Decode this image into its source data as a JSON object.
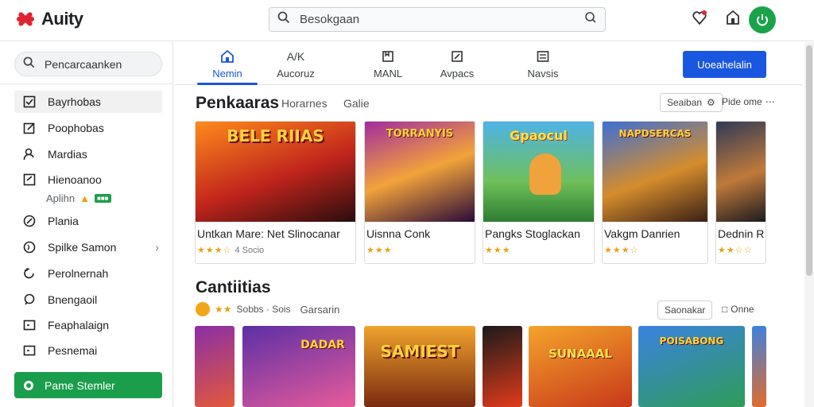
{
  "app": {
    "name": "Auity"
  },
  "header": {
    "search_text": "Besokgaan",
    "icons": [
      "notification-icon",
      "store-icon",
      "info-icon",
      "power-icon"
    ]
  },
  "sidebar": {
    "search_text": "Pencarcaanken",
    "items": [
      {
        "label": "Bayrhobas",
        "icon": "checkbox-icon",
        "active": true
      },
      {
        "label": "Poophobas",
        "icon": "edit-icon"
      },
      {
        "label": "Mardias",
        "icon": "person-icon"
      },
      {
        "label": "Hienoanoo",
        "icon": "edit-box-icon"
      },
      {
        "label": "Plania",
        "icon": "compass-icon"
      },
      {
        "label": "Spilke Samon",
        "icon": "globe-icon",
        "chevron": "›"
      },
      {
        "label": "Perolnernah",
        "icon": "refresh-icon"
      },
      {
        "label": "Bnengaoil",
        "icon": "chat-icon"
      },
      {
        "label": "Feaphalaign",
        "icon": "flag-icon"
      },
      {
        "label": "Pesnemai",
        "icon": "card-icon"
      }
    ],
    "sub_item": {
      "label": "Aplihn",
      "badge": "■■■"
    },
    "cta_label": "Pame Stemler"
  },
  "tabs": [
    {
      "label": "Nemin",
      "icon": "home-icon",
      "active": true
    },
    {
      "label": "Aucoruz",
      "icon_text": "A/K"
    },
    {
      "label": "MANL",
      "icon": "bookmark-icon"
    },
    {
      "label": "Avpacs",
      "icon": "edit-square-icon"
    },
    {
      "label": "Navsis",
      "icon": "list-icon"
    }
  ],
  "primary_button": "Uoeahelalin",
  "section1": {
    "title": "Penkaaras",
    "meta1": "Horarnes",
    "meta2": "Galie",
    "filter_label": "Seaiban",
    "more_label": "Pide ome",
    "cards": [
      {
        "title": "Untkan Mare: Net Slinocanar",
        "art_text": "BELE RIIAS",
        "stars": "★★★☆",
        "count": "4 Socio",
        "colors": [
          "#ff8a1c",
          "#c0241c",
          "#2a0d0d"
        ]
      },
      {
        "title": "Uisnna Conk",
        "art_text": "TORRANYIS",
        "stars": "★★★",
        "count": "",
        "colors": [
          "#a22b9f",
          "#f2a33a",
          "#2a0a3a"
        ]
      },
      {
        "title": "Pangks Stoglackan",
        "art_text": "Gpaocul",
        "stars": "★★★",
        "count": "",
        "colors": [
          "#4fb3e6",
          "#6fc05a",
          "#2e7d32"
        ]
      },
      {
        "title": "Vakgm Danrien",
        "art_text": "NAPDSERCAS",
        "stars": "★★★☆",
        "count": "",
        "colors": [
          "#3c6fd6",
          "#d58d2c",
          "#3a1f16"
        ]
      },
      {
        "title": "Dednin R",
        "art_text": "",
        "stars": "★★☆☆",
        "count": "",
        "colors": [
          "#2f3a58",
          "#c07a3a",
          "#1c1a20"
        ]
      }
    ]
  },
  "section2": {
    "title": "Cantiitias",
    "rating_text": "Sobbs · Sois",
    "meta": "Garsarin",
    "filter_label": "Saonakar",
    "more_label": "Onne",
    "stars": "★★",
    "tiles": [
      {
        "art_text": "",
        "colors": [
          "#8a2fa6",
          "#e4593b"
        ]
      },
      {
        "art_text": "DADAR",
        "colors": [
          "#5b2fa6",
          "#e85b9a"
        ]
      },
      {
        "art_text": "SAMIEST",
        "colors": [
          "#f0a32c",
          "#7a2a10"
        ]
      },
      {
        "art_text": "",
        "colors": [
          "#1a1a1a",
          "#e23b1b"
        ]
      },
      {
        "art_text": "SUNAAAL",
        "colors": [
          "#f4a42b",
          "#c8381a"
        ]
      },
      {
        "art_text": "POISABONG",
        "colors": [
          "#3b82e0",
          "#2e9c58"
        ]
      },
      {
        "art_text": "",
        "colors": [
          "#3b82e0",
          "#e46b2a"
        ]
      }
    ]
  }
}
